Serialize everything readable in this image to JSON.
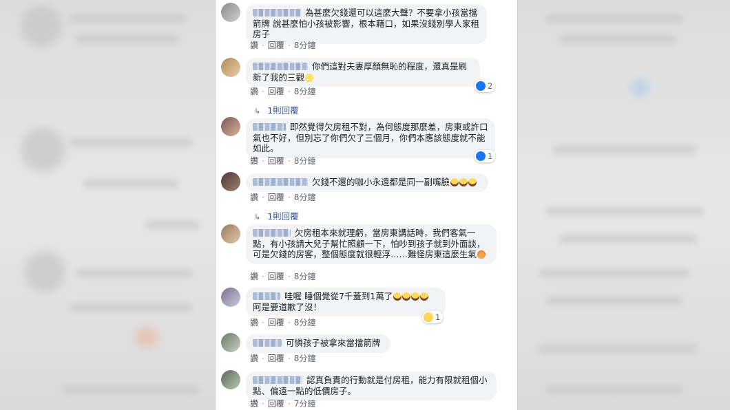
{
  "comments": [
    {
      "text": "為甚麼欠錢還可以這麼大聲？不要拿小孩當擋箭牌 說甚麼怕小孩被影響，根本藉口，如果沒錢別學人家租房子",
      "like": "讚",
      "reply": "回覆",
      "time": "8分鐘"
    },
    {
      "text": "你們這對夫妻厚顏無恥的程度，還真是刷新了我的三觀",
      "emoji": "sweat",
      "like": "讚",
      "reply": "回覆",
      "time": "8分鐘",
      "reaction_count": "2"
    },
    {
      "text": "即然覺得欠房租不對，為何態度那麼差，房東或許口氣也不好，但別忘了你們欠了三個月，你們本應該態度就不能如此。",
      "like": "讚",
      "reply": "回覆",
      "time": "8分鐘",
      "reaction_count": "1"
    },
    {
      "text": "欠錢不還的咖小永遠都是同一副嘴臉",
      "like": "讚",
      "reply": "回覆",
      "time": "8分鐘"
    },
    {
      "text": "欠房租本來就理虧，當房東講話時，我們客氣一點，有小孩請大兒子幫忙照顧一下，怕吵到孩子就到外面談，可是欠錢的房客，整個態度就很輕浮……難怪房東這麼生氣",
      "like": "讚",
      "reply": "回覆",
      "time": "8分鐘"
    },
    {
      "text": "哇喔 睡個覺從7千蓋到1萬了",
      "text2": "阿是要道歉了沒！",
      "like": "讚",
      "reply": "回覆",
      "time": "8分鐘",
      "reaction_count": "1"
    },
    {
      "text": "可憐孩子被拿來當擋箭牌",
      "like": "讚",
      "reply": "回覆",
      "time": "8分鐘"
    },
    {
      "text": "認真負責的行動就是付房租，能力有限就租個小點、偏遠一點的低價房子。",
      "like": "讚",
      "reply": "回覆",
      "time": "7分鐘"
    }
  ],
  "replies_1": "1則回覆",
  "replies_2": "1則回覆",
  "colors": {
    "link": "#385898",
    "bubble": "#f2f3f5",
    "like_blue": "#1877f2"
  }
}
